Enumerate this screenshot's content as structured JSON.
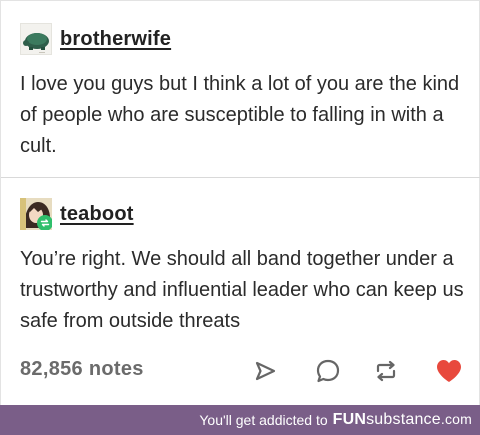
{
  "posts": [
    {
      "username": "brotherwife",
      "avatar_icon": "turtle-avatar",
      "body": "I love you guys but I think a lot of you are the kind of people who are susceptible to falling in with a cult."
    },
    {
      "username": "teaboot",
      "avatar_icon": "anime-avatar-with-reblog-badge",
      "body": "You’re right. We should all band together under a trustworthy and influential leader who can keep us safe from outside threats"
    }
  ],
  "footer": {
    "notes": "82,856 notes",
    "icons": [
      "share-icon",
      "reply-icon",
      "reblog-icon",
      "heart-icon"
    ],
    "heart_color": "#e8493d",
    "icon_color": "#666666"
  },
  "banner": {
    "text": "You'll get addicted to",
    "brand_fun": "FUN",
    "brand_rest": "substance",
    "brand_com": ".com",
    "background": "#7a5e88"
  }
}
